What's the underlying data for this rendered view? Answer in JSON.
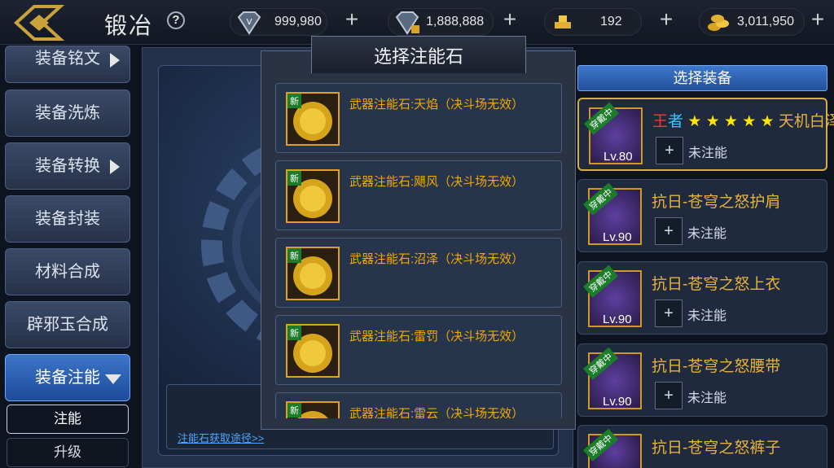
{
  "header": {
    "title": "锻冶",
    "help_icon": "?",
    "resources": [
      {
        "name": "diamond",
        "value": "999,980"
      },
      {
        "name": "bound-diamond",
        "value": "1,888,888"
      },
      {
        "name": "gold-bars",
        "value": "192"
      },
      {
        "name": "gold-coins",
        "value": "3,011,950"
      }
    ],
    "plus": "+"
  },
  "menu": {
    "items": [
      {
        "label": "装备铭文",
        "has_arrow": true
      },
      {
        "label": "装备洗炼"
      },
      {
        "label": "装备转换",
        "has_arrow": true
      },
      {
        "label": "装备封装"
      },
      {
        "label": "材料合成"
      },
      {
        "label": "辟邪玉合成"
      },
      {
        "label": "装备注能",
        "active": true
      }
    ],
    "sub_items": [
      {
        "label": "注能",
        "active": true
      },
      {
        "label": "升级"
      }
    ]
  },
  "center": {
    "link_text": "注能石获取途径>>"
  },
  "popup": {
    "title": "选择注能石",
    "new_badge": "新",
    "stones": [
      {
        "name": "武器注能石:天焰（决斗场无效）",
        "glyph": "天焰"
      },
      {
        "name": "武器注能石:飓风（决斗场无效）",
        "glyph": "飓风"
      },
      {
        "name": "武器注能石:沼泽（决斗场无效）",
        "glyph": "沼泽"
      },
      {
        "name": "武器注能石:雷罚（决斗场无效）",
        "glyph": "雷罚"
      },
      {
        "name": "武器注能石:雷云（决斗场无效）",
        "glyph": "雷云"
      }
    ]
  },
  "right_panel": {
    "header": "选择装备",
    "wearing_badge": "穿戴中",
    "add_label": "+",
    "equipment": [
      {
        "name_prefix_1": "王",
        "name_prefix_2": "者",
        "stars": "★ ★ ★ ★ ★",
        "name": "天机白泽",
        "level": "Lv.80",
        "status": "未注能"
      },
      {
        "name": "抗日-苍穹之怒护肩",
        "level": "Lv.90",
        "status": "未注能"
      },
      {
        "name": "抗日-苍穹之怒上衣",
        "level": "Lv.90",
        "status": "未注能"
      },
      {
        "name": "抗日-苍穹之怒腰带",
        "level": "Lv.90",
        "status": "未注能"
      },
      {
        "name": "抗日-苍穹之怒裤子",
        "level": "",
        "status": ""
      }
    ]
  },
  "colors": {
    "accent_gold": "#f2a900",
    "active_blue": "#3d76c8",
    "wearing_green": "#1b7d2a"
  }
}
